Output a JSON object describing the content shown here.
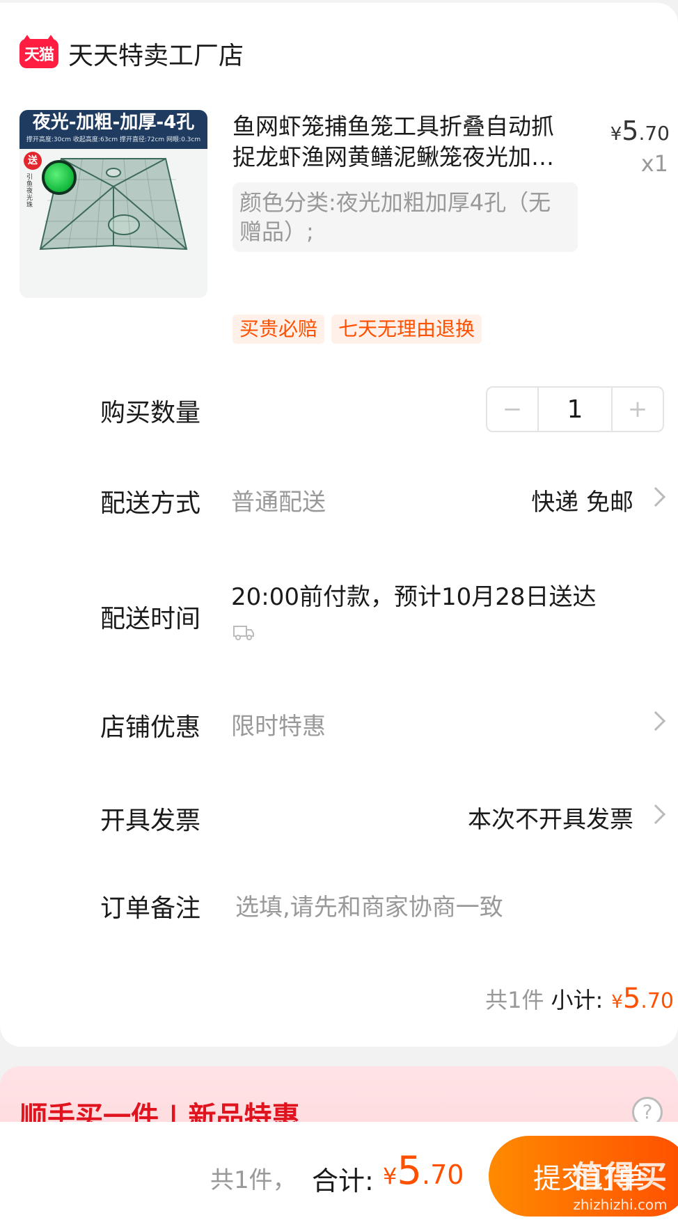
{
  "shop": {
    "badge": "天猫",
    "name": "天天特卖工厂店"
  },
  "product": {
    "image_header": "夜光-加粗-加厚-4孔",
    "image_sub": "撑开高度:30cm 收起高度:63cm 撑开直径:72cm 网眼:0.3cm",
    "image_gift": "送",
    "image_gift_text": "引鱼夜光珠",
    "title": "鱼网虾笼捕鱼笼工具折叠自动抓捉龙虾渔网黄鳝泥鳅笼夜光加粗加厚4孔",
    "price_currency": "¥",
    "price_int": "5",
    "price_dec": ".70",
    "quantity": "x1",
    "sku": "颜色分类:夜光加粗加厚4孔（无赠品）;",
    "tags": [
      "买贵必赔",
      "七天无理由退换"
    ]
  },
  "quantity_row": {
    "label": "购买数量",
    "minus": "−",
    "value": "1",
    "plus": "+"
  },
  "delivery": {
    "label": "配送方式",
    "method": "普通配送",
    "value": "快递 免邮"
  },
  "delivery_time": {
    "label": "配送时间",
    "value": "20:00前付款，预计10月28日送达"
  },
  "shop_discount": {
    "label": "店铺优惠",
    "value": "限时特惠"
  },
  "invoice": {
    "label": "开具发票",
    "value": "本次不开具发票"
  },
  "remark": {
    "label": "订单备注",
    "placeholder": "选填,请先和商家协商一致"
  },
  "subtotal": {
    "count": "共1件",
    "label": "小计:",
    "currency": "¥",
    "int": "5",
    "dec": ".70"
  },
  "promo": {
    "title": "顺手买一件 | 新品特惠",
    "help": "?"
  },
  "bottom": {
    "count": "共1件，",
    "label": "合计:",
    "currency": "¥",
    "int": "5",
    "dec": ".70",
    "submit": "提交订单"
  },
  "watermark": {
    "cn": "值得买",
    "en": "zhizhizhi.com"
  },
  "colors": {
    "accent": "#ff5000",
    "tmall_red": "#ff1e42",
    "submit_start": "#ff8a00",
    "submit_end": "#ff4e00"
  }
}
